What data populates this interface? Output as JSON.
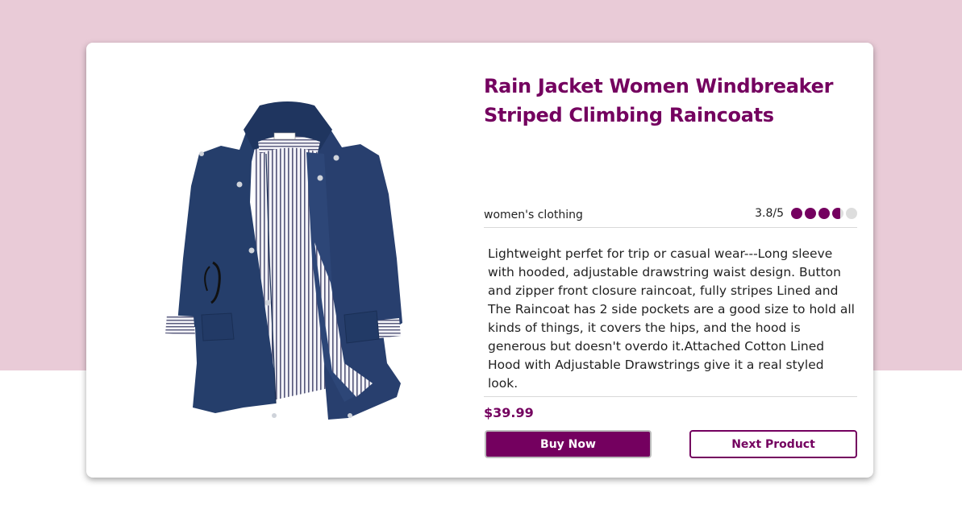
{
  "colors": {
    "accent": "#74005f",
    "background_top": "#e9cbd7"
  },
  "product": {
    "image_icon": "rain-jacket-image",
    "title": "Rain Jacket Women Windbreaker Striped Climbing Raincoats",
    "category": "women's clothing",
    "rating_text": "3.8/5",
    "rating_value": 3.8,
    "rating_max": 5,
    "description": "Lightweight perfet for trip or casual wear---Long sleeve with hooded, adjustable drawstring waist design. Button and zipper front closure raincoat, fully stripes Lined and The Raincoat has 2 side pockets are a good size to hold all kinds of things, it covers the hips, and the hood is generous but doesn't overdo it.Attached Cotton Lined Hood with Adjustable Drawstrings give it a real styled look.",
    "price": "$39.99"
  },
  "actions": {
    "buy_label": "Buy Now",
    "next_label": "Next Product"
  }
}
